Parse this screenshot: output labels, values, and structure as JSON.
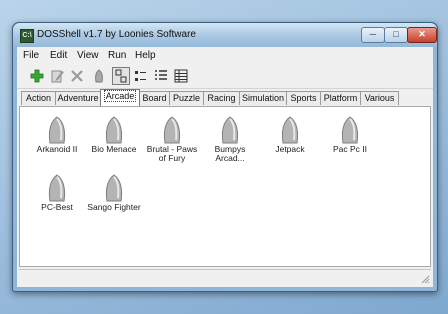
{
  "window": {
    "title": "DOSShell v1.7 by Loonies Software",
    "icon_text": "C:\\"
  },
  "window_controls": {
    "minimize": "─",
    "maximize": "□",
    "close": "✕"
  },
  "menu": [
    {
      "label": "File"
    },
    {
      "label": "Edit"
    },
    {
      "label": "View"
    },
    {
      "label": "Run"
    },
    {
      "label": "Help"
    }
  ],
  "toolbar": [
    {
      "icon": "add-icon"
    },
    {
      "icon": "edit-icon"
    },
    {
      "icon": "delete-icon"
    },
    {
      "icon": "run-icon"
    },
    {
      "icon": "large-icons-view-icon",
      "selected": true
    },
    {
      "icon": "small-icons-view-icon"
    },
    {
      "icon": "list-view-icon"
    },
    {
      "icon": "details-view-icon"
    }
  ],
  "tabs": [
    {
      "label": "Action"
    },
    {
      "label": "Adventure"
    },
    {
      "label": "Arcade",
      "active": true
    },
    {
      "label": "Board"
    },
    {
      "label": "Puzzle"
    },
    {
      "label": "Racing"
    },
    {
      "label": "Simulation"
    },
    {
      "label": "Sports"
    },
    {
      "label": "Platform"
    },
    {
      "label": "Various"
    }
  ],
  "programs": [
    {
      "label": "Arkanoid II"
    },
    {
      "label": "Bio Menace"
    },
    {
      "label": "Brutal - Paws\nof Fury"
    },
    {
      "label": "Bumpys\nArcad..."
    },
    {
      "label": "Jetpack"
    },
    {
      "label": "Pac Pc II"
    },
    {
      "label": "PC-Best"
    },
    {
      "label": "Sango Fighter"
    }
  ],
  "statusbar": {
    "text": ""
  },
  "colors": {
    "accent_green": "#39a935",
    "titlebar": "#a8c7e3",
    "close": "#c8402c"
  }
}
